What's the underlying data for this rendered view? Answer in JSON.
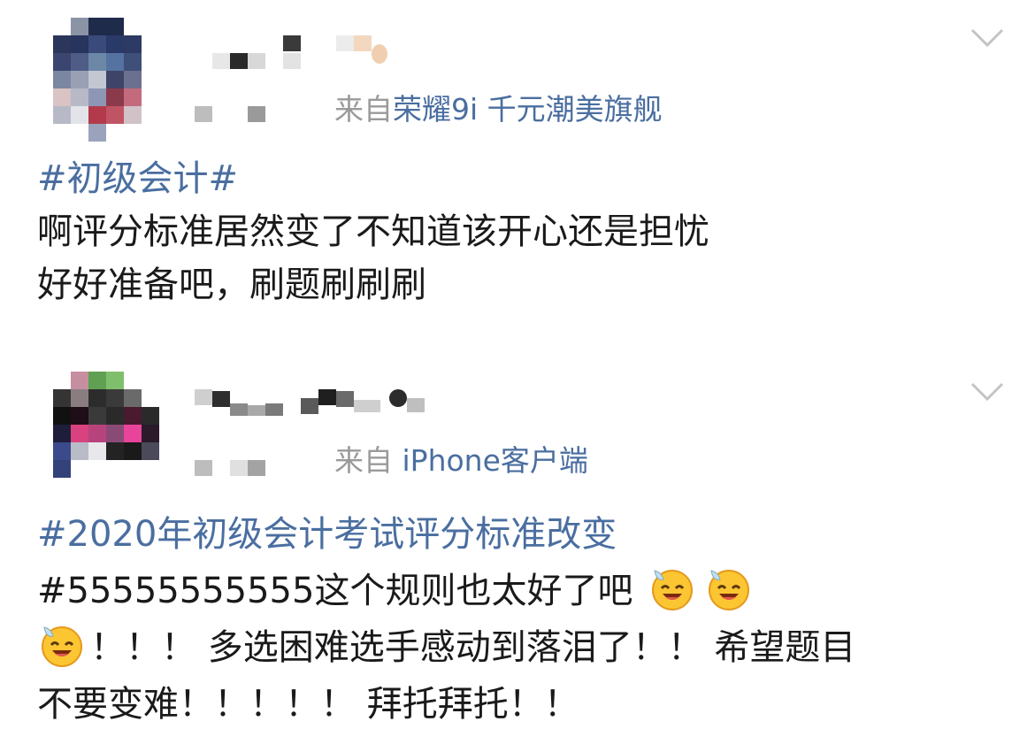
{
  "posts": [
    {
      "source_prefix": "来自",
      "source_client": "荣耀9i 千元潮美旗舰",
      "hashtag": "#初级会计#",
      "lines": [
        "啊评分标准居然变了不知道该开心还是担忧",
        "好好准备吧，刷题刷刷刷"
      ]
    },
    {
      "source_prefix": "来自",
      "source_client": "iPhone客户端",
      "hashtag": "#2020年初级会计考试评分标准改变",
      "line1_text": "#55555555555这个规则也太好了吧",
      "line2_text": "！！！ 多选困难选手感动到落泪了！！ 希望题目",
      "line3_text": "不要变难！！！！！ 拜托拜托！！",
      "emoji_name": "laugh-sweat-emoji"
    }
  ],
  "colors": {
    "link": "#4a6ea0",
    "meta": "#9a9a9a",
    "text": "#1a1a1a"
  },
  "icons": {
    "chevron": "chevron-down-icon"
  }
}
